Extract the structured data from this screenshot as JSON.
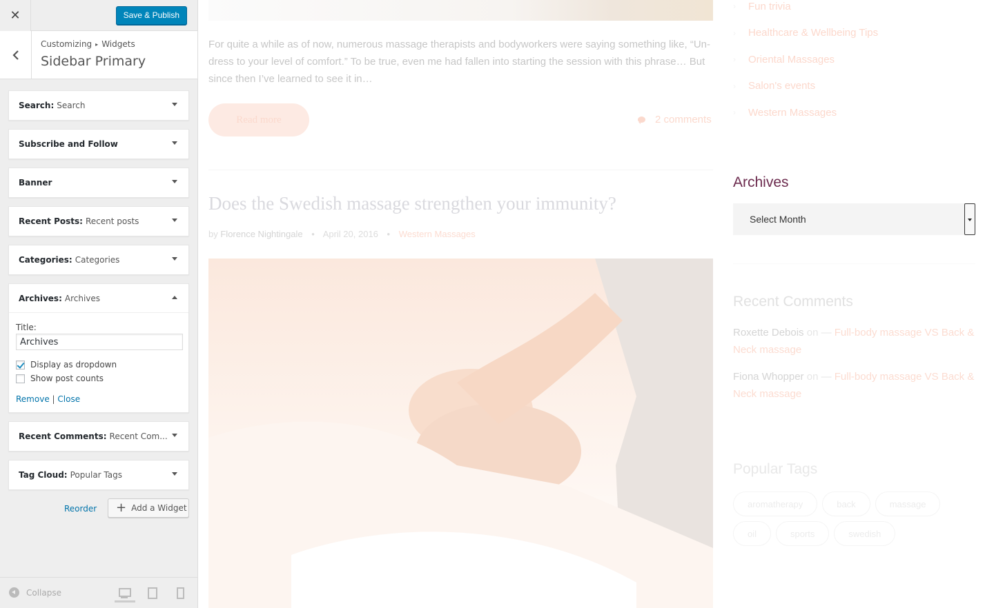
{
  "customizer": {
    "close_icon": "close-icon",
    "save_label": "Save & Publish",
    "breadcrumb_root": "Customizing",
    "breadcrumb_sep": "▸",
    "breadcrumb_current": "Widgets",
    "section_title": "Sidebar Primary",
    "widgets": [
      {
        "name": "Search:",
        "title": "Search"
      },
      {
        "name": "Subscribe and Follow",
        "title": ""
      },
      {
        "name": "Banner",
        "title": ""
      },
      {
        "name": "Recent Posts:",
        "title": "Recent posts"
      },
      {
        "name": "Categories:",
        "title": "Categories"
      },
      {
        "name": "Archives:",
        "title": "Archives"
      },
      {
        "name": "Recent Comments:",
        "title": "Recent Com..."
      },
      {
        "name": "Tag Cloud:",
        "title": "Popular Tags"
      }
    ],
    "archives_form": {
      "title_label": "Title:",
      "title_value": "Archives",
      "dropdown_label": "Display as dropdown",
      "dropdown_checked": true,
      "counts_label": "Show post counts",
      "counts_checked": false,
      "remove_label": "Remove",
      "divider": "|",
      "close_label": "Close"
    },
    "reorder_label": "Reorder",
    "add_widget_label": "Add a Widget",
    "collapse_label": "Collapse"
  },
  "preview": {
    "excerpt": "For quite a while as of now, numerous massage therapists and bodyworkers were saying something like, “Un-dress to your level of comfort.” To be true, even me had fallen into starting the session with this phrase… But since then I’ve learned to see it in…",
    "read_more": "Read more",
    "comments": "2 comments",
    "post_title": "Does the Swedish massage strengthen your immunity?",
    "meta_by": "by",
    "meta_author": "Florence Nightingale",
    "meta_date": "April 20, 2016",
    "meta_category": "Western Massages",
    "category_links": [
      "Fun trivia",
      "Healthcare & Wellbeing Tips",
      "Oriental Massages",
      "Salon's events",
      "Western Massages"
    ],
    "archives_title": "Archives",
    "archives_select": "Select Month",
    "recent_comments_title": "Recent Comments",
    "recent_comments": [
      {
        "author": "Roxette Debois",
        "on": "on —",
        "post": "Full-body massage VS Back & Neck massage"
      },
      {
        "author": "Fiona Whopper",
        "on": "on —",
        "post": "Full-body massage VS Back & Neck massage"
      }
    ],
    "popular_tags_title": "Popular Tags",
    "tags": [
      "aromatherapy",
      "back",
      "massage",
      "oil",
      "sports",
      "swedish"
    ]
  }
}
